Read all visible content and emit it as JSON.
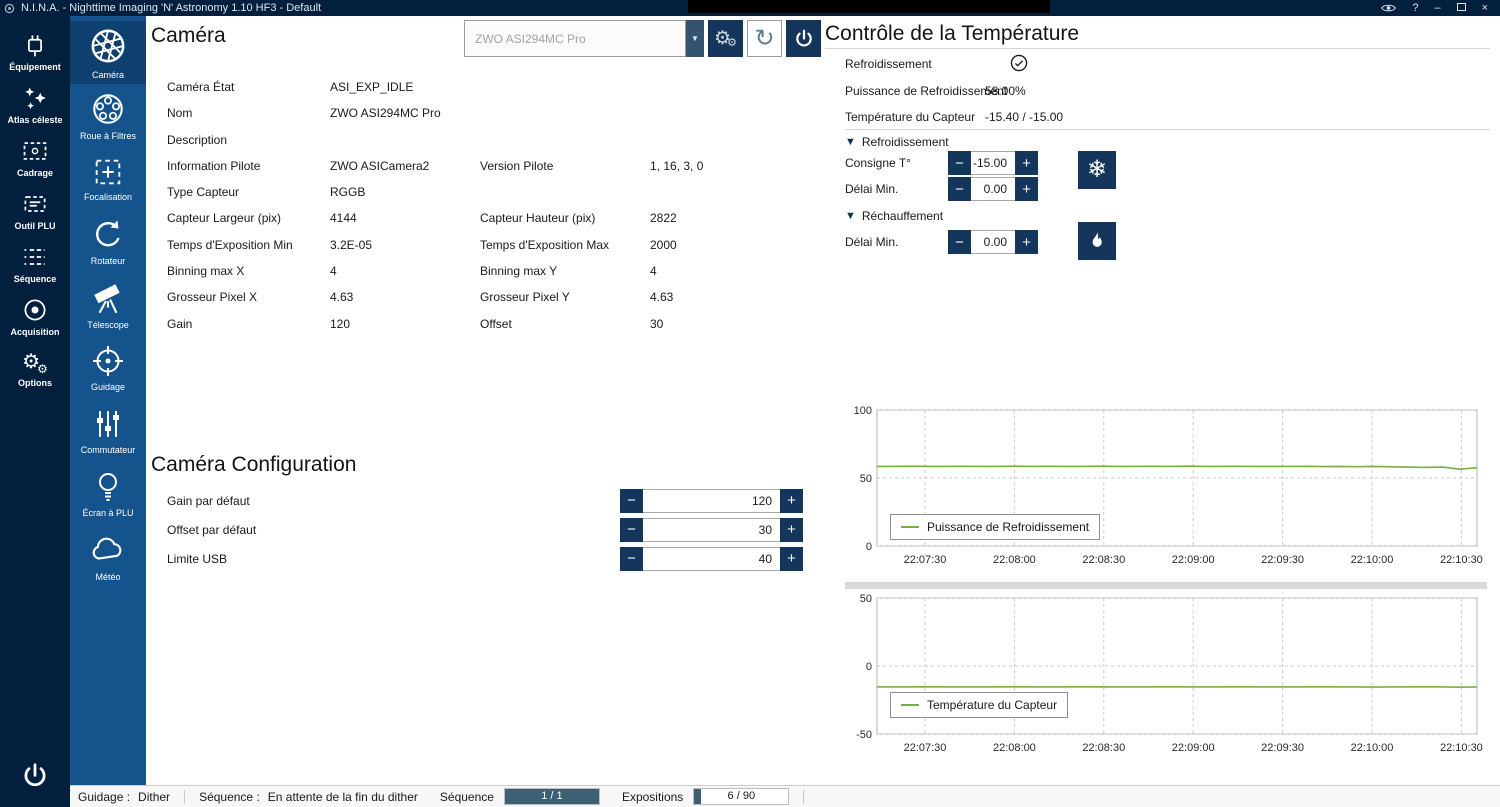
{
  "titlebar": {
    "title": "N.I.N.A. - Nighttime Imaging 'N' Astronomy 1.10 HF3   -   Default",
    "help": "?",
    "minimize": "–",
    "close": "×"
  },
  "icons": {
    "gear": "⚙",
    "refresh": "↻",
    "snowflake": "❄",
    "dropdown": "▼",
    "expander": "▼",
    "minus": "−",
    "plus": "+"
  },
  "colors": {
    "sidebar_dark": "#02203d",
    "sidebar_blue": "#14538c",
    "button_navy": "#14365c",
    "chart_line": "#76b041",
    "progress_fill": "#3d6075"
  },
  "main_nav": {
    "items": [
      {
        "id": "equipment",
        "label": "Équipement",
        "active": true
      },
      {
        "id": "sky-atlas",
        "label": "Atlas céleste",
        "active": false
      },
      {
        "id": "framing",
        "label": "Cadrage",
        "active": false
      },
      {
        "id": "flat-wizard",
        "label": "Outil PLU",
        "active": false
      },
      {
        "id": "sequence",
        "label": "Séquence",
        "active": false
      },
      {
        "id": "imaging",
        "label": "Acquisition",
        "active": false
      },
      {
        "id": "options",
        "label": "Options",
        "active": false
      }
    ]
  },
  "equipment_nav": {
    "items": [
      {
        "id": "camera",
        "label": "Caméra",
        "active": true
      },
      {
        "id": "filter-wheel",
        "label": "Roue à Filtres",
        "active": false
      },
      {
        "id": "focuser",
        "label": "Focalisation",
        "active": false
      },
      {
        "id": "rotator",
        "label": "Rotateur",
        "active": false
      },
      {
        "id": "telescope",
        "label": "Télescope",
        "active": false
      },
      {
        "id": "guider",
        "label": "Guidage",
        "active": false
      },
      {
        "id": "switch",
        "label": "Commutateur",
        "active": false
      },
      {
        "id": "flat-panel",
        "label": "Écran à PLU",
        "active": false
      },
      {
        "id": "weather",
        "label": "Météo",
        "active": false
      }
    ]
  },
  "camera_panel": {
    "title": "Caméra",
    "device_select": "ZWO ASI294MC Pro",
    "info_rows": [
      {
        "l1": "Caméra État",
        "v1": "ASI_EXP_IDLE",
        "l2": "",
        "v2": ""
      },
      {
        "l1": "Nom",
        "v1": "ZWO ASI294MC Pro",
        "l2": "",
        "v2": ""
      },
      {
        "l1": "Description",
        "v1": "",
        "l2": "",
        "v2": ""
      },
      {
        "l1": "Information Pilote",
        "v1": "ZWO ASICamera2",
        "l2": "Version Pilote",
        "v2": "1, 16, 3, 0"
      },
      {
        "l1": "Type Capteur",
        "v1": "RGGB",
        "l2": "",
        "v2": ""
      },
      {
        "l1": "Capteur Largeur (pix)",
        "v1": "4144",
        "l2": "Capteur Hauteur (pix)",
        "v2": "2822"
      },
      {
        "l1": "Temps d'Exposition Min",
        "v1": "3.2E-05",
        "l2": "Temps d'Exposition Max",
        "v2": "2000"
      },
      {
        "l1": "Binning max X",
        "v1": "4",
        "l2": "Binning max Y",
        "v2": "4"
      },
      {
        "l1": "Grosseur Pixel X",
        "v1": "4.63",
        "l2": "Grosseur Pixel Y",
        "v2": "4.63"
      },
      {
        "l1": "Gain",
        "v1": "120",
        "l2": "Offset",
        "v2": "30"
      }
    ],
    "config": {
      "title": "Caméra Configuration",
      "rows": [
        {
          "label": "Gain par défaut",
          "value": "120"
        },
        {
          "label": "Offset par défaut",
          "value": "30"
        },
        {
          "label": "Limite USB",
          "value": "40"
        }
      ]
    }
  },
  "temperature_panel": {
    "title": "Contrôle de la Température",
    "cooler_label": "Refroidissement",
    "power_label": "Puissance de Refroidissement",
    "power_value": "58.00%",
    "sensor_label": "Température du Capteur",
    "sensor_value": "-15.40 /  -15.00",
    "cooling_section": {
      "title": "Refroidissement",
      "target_label": "Consigne T°",
      "target_value": "-15.00",
      "duration_label": "Délai Min.",
      "duration_value": "0.00"
    },
    "warming_section": {
      "title": "Réchauffement",
      "duration_label": "Délai Min.",
      "duration_value": "0.00"
    }
  },
  "statusbar": {
    "guiding_label": "Guidage :",
    "guiding_value": "Dither",
    "sequence_label": "Séquence :",
    "sequence_value": "En attente de la fin du dither",
    "sequence_progress_label": "Séquence",
    "sequence_progress_text": "1 / 1",
    "sequence_progress_pct": 100,
    "exposures_label": "Expositions",
    "exposures_progress_text": "6 / 90",
    "exposures_progress_pct": 7
  },
  "chart_data": [
    {
      "type": "line",
      "legend": "Puissance de Refroidissement",
      "legend_position": "bottom-left-inside",
      "grid": true,
      "ylim": [
        0,
        100
      ],
      "y_ticks": [
        0,
        50,
        100
      ],
      "x_ticks": [
        "22:07:30",
        "22:08:00",
        "22:08:30",
        "22:09:00",
        "22:09:30",
        "22:10:00",
        "22:10:30"
      ],
      "series": [
        {
          "name": "Puissance de Refroidissement",
          "color": "#76b041",
          "values": [
            58.5,
            58.5,
            58.7,
            58.5,
            58.5,
            58.6,
            58.5,
            58.5,
            58.7,
            58.5,
            58.6,
            58.5,
            58.5,
            58.7,
            58.5,
            58.5,
            58.6,
            58.5,
            58.7,
            58.5,
            58.5,
            58.6,
            58.5,
            58.5,
            58.5,
            58.6,
            58.4,
            58.5,
            58.3,
            58.5,
            58.2,
            58.0,
            57.8,
            58.0,
            56.5,
            57.6
          ]
        }
      ]
    },
    {
      "type": "line",
      "legend": "Température du Capteur",
      "legend_position": "bottom-left-inside",
      "grid": true,
      "ylim": [
        -50,
        50
      ],
      "y_ticks": [
        -50,
        0,
        50
      ],
      "x_ticks": [
        "22:07:30",
        "22:08:00",
        "22:08:30",
        "22:09:00",
        "22:09:30",
        "22:10:00",
        "22:10:30"
      ],
      "series": [
        {
          "name": "Température du Capteur",
          "color": "#76b041",
          "values": [
            -15.4,
            -15.4,
            -15.4,
            -15.3,
            -15.4,
            -15.4,
            -15.4,
            -15.4,
            -15.3,
            -15.4,
            -15.4,
            -15.4,
            -15.3,
            -15.4,
            -15.4,
            -15.4,
            -15.4,
            -15.3,
            -15.4,
            -15.4,
            -15.4,
            -15.3,
            -15.4,
            -15.4,
            -15.4,
            -15.4,
            -15.3,
            -15.4,
            -15.4,
            -15.5,
            -15.4,
            -15.4,
            -15.3,
            -15.4,
            -15.6,
            -15.4
          ]
        }
      ]
    }
  ]
}
